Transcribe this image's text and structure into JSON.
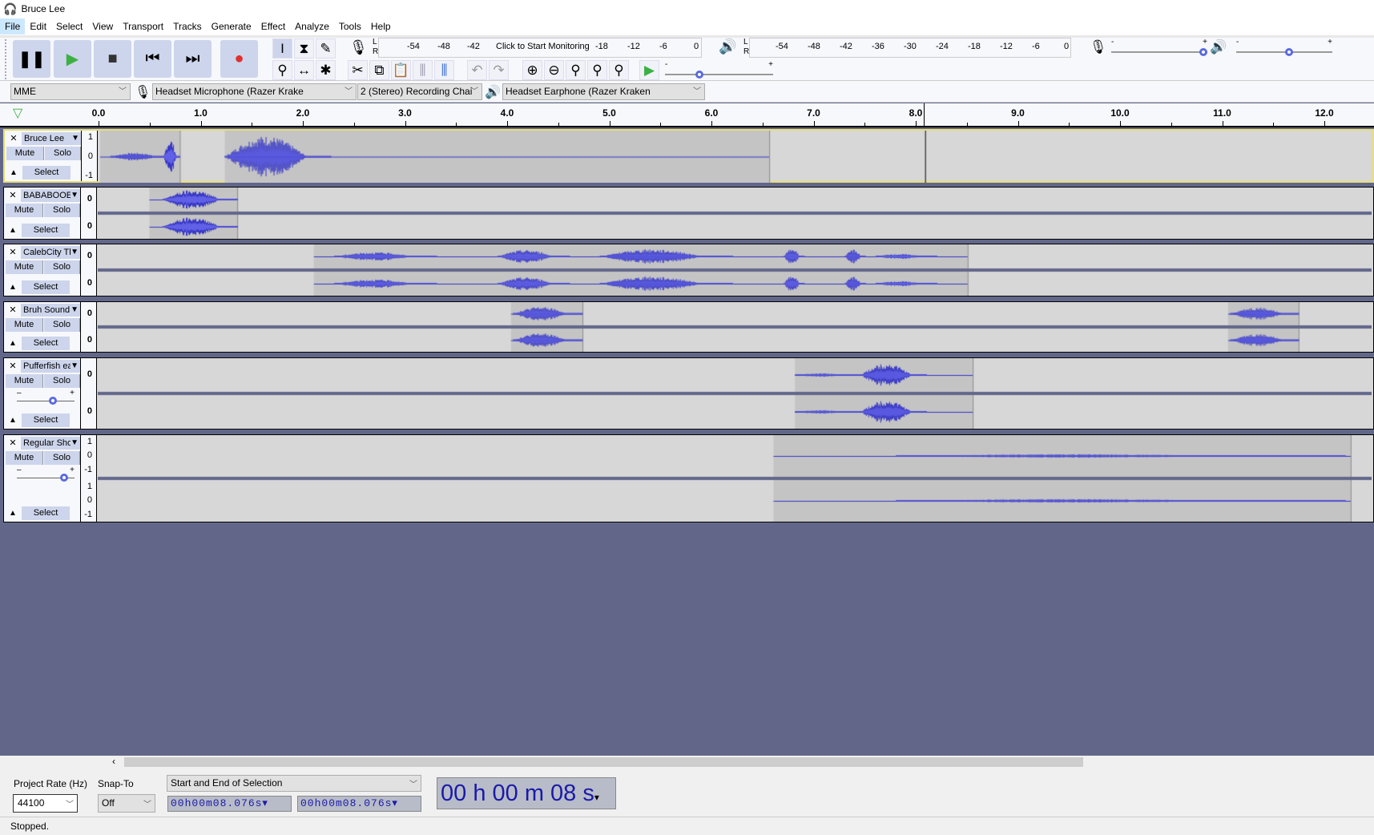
{
  "window": {
    "title": "Bruce Lee"
  },
  "menu": [
    "File",
    "Edit",
    "Select",
    "View",
    "Transport",
    "Tracks",
    "Generate",
    "Effect",
    "Analyze",
    "Tools",
    "Help"
  ],
  "record_meter": {
    "ticks": [
      "-54",
      "-48",
      "-42",
      "-18",
      "-12",
      "-6",
      "0"
    ],
    "monitor_label": "Click to Start Monitoring",
    "l": "L",
    "r": "R"
  },
  "playback_meter": {
    "ticks": [
      "-54",
      "-48",
      "-42",
      "-36",
      "-30",
      "-24",
      "-18",
      "-12",
      "-6",
      "0"
    ],
    "l": "L",
    "r": "R"
  },
  "mixer": {
    "minus": "-",
    "plus": "+",
    "input_volume": 1.0,
    "output_volume": 0.55
  },
  "play_at_speed": {
    "minus": "-",
    "plus": "+",
    "speed": 0.3
  },
  "devices": {
    "host": "MME",
    "input": "Headset Microphone (Razer Krake",
    "channels": "2 (Stereo) Recording Chai",
    "output": "Headset Earphone (Razer Kraken"
  },
  "ruler": {
    "labels": [
      "0.0",
      "1.0",
      "2.0",
      "3.0",
      "4.0",
      "5.0",
      "6.0",
      "7.0",
      "8.0",
      "9.0",
      "10.0",
      "11.0",
      "12.0"
    ],
    "cursor_seconds": 8.076
  },
  "colors": {
    "waveform": "#3232c8",
    "clip_bg": "#c4c4c4",
    "track_bg": "#d7d7d7",
    "selected_border": "#e8e070",
    "workspace": "#62678a"
  },
  "track_common": {
    "mute": "Mute",
    "solo": "Solo",
    "select": "Select"
  },
  "tracks": [
    {
      "name": "Bruce Lee",
      "channels": 1,
      "selected": true,
      "scale": [
        "1",
        "0",
        "-1"
      ],
      "clips": [
        [
          0,
          0.78
        ],
        [
          1.22,
          6.55
        ]
      ],
      "bursts": [
        [
          0.1,
          0.7,
          0.15
        ],
        [
          0.62,
          0.78,
          0.7
        ],
        [
          1.22,
          2.26,
          0.8
        ]
      ]
    },
    {
      "name": "BABABOOEY",
      "channels": 2,
      "scale": [
        "0"
      ],
      "clips": [
        [
          0.49,
          1.35
        ]
      ],
      "bursts": [
        [
          0.62,
          1.35,
          0.8
        ]
      ]
    },
    {
      "name": "CalebCity Th",
      "channels": 2,
      "scale": [
        "0"
      ],
      "clips": [
        [
          2.1,
          8.5
        ]
      ],
      "bursts": [
        [
          2.3,
          3.3,
          0.35
        ],
        [
          3.9,
          4.6,
          0.55
        ],
        [
          4.9,
          6.2,
          0.6
        ],
        [
          6.7,
          6.9,
          0.7
        ],
        [
          7.3,
          7.5,
          0.6
        ],
        [
          7.6,
          8.2,
          0.2
        ]
      ]
    },
    {
      "name": "Bruh Sound",
      "channels": 2,
      "scale": [
        "0"
      ],
      "clips": [
        [
          4.03,
          4.73
        ],
        [
          11.05,
          11.74
        ]
      ],
      "bursts": [
        [
          4.05,
          4.73,
          0.6
        ],
        [
          11.07,
          11.74,
          0.55
        ]
      ]
    },
    {
      "name": "Pufferfish ea",
      "channels": 2,
      "scale": [
        "0"
      ],
      "gain": 0.6,
      "clips": [
        [
          6.81,
          8.55
        ]
      ],
      "bursts": [
        [
          6.81,
          7.45,
          0.1
        ],
        [
          7.45,
          8.1,
          0.7
        ]
      ]
    },
    {
      "name": "Regular Sho",
      "channels": 2,
      "scale": [
        "1",
        "0",
        "-1"
      ],
      "gain": 0.8,
      "clips": [
        [
          6.6,
          12.25
        ]
      ],
      "bursts": [
        [
          7.8,
          12.2,
          0.08
        ]
      ]
    }
  ],
  "selection_toolbar": {
    "rate_label": "Project Rate (Hz)",
    "rate": "44100",
    "snap_label": "Snap-To",
    "snap": "Off",
    "mode": "Start and End of Selection",
    "start": "00h00m08.076s",
    "end": "00h00m08.076s"
  },
  "time_display": "00 h 00 m 08 s",
  "status": "Stopped."
}
